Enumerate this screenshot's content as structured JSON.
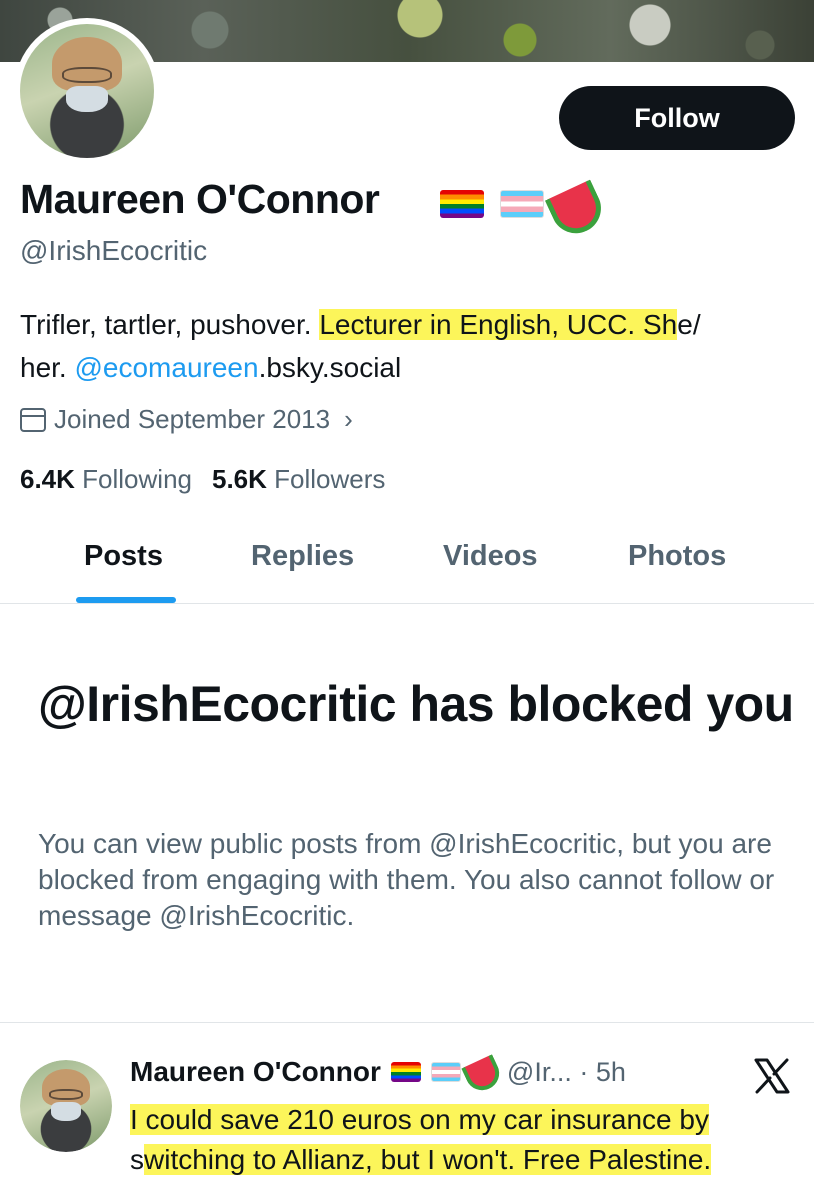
{
  "profile": {
    "name": "Maureen O'Connor",
    "handle": "@IrishEcocritic",
    "bio_prefix": "Trifler, tartler, pushover. ",
    "bio_highlight_1": "Lecturer in English, UCC. Sh",
    "bio_mid": "e/ ",
    "bio_line2_prefix": "her. ",
    "bio_link": "@ecomaureen",
    "bio_suffix": ".bsky.social",
    "joined": "Joined September 2013",
    "following_count": "6.4K",
    "following_label": "Following",
    "followers_count": "5.6K",
    "followers_label": "Followers",
    "icons": [
      "rainbow-flag-icon",
      "trans-flag-icon",
      "watermelon-icon",
      "calendar-icon",
      "chevron-right-icon"
    ]
  },
  "actions": {
    "follow_label": "Follow"
  },
  "tabs": [
    {
      "label": "Posts",
      "active": true
    },
    {
      "label": "Replies"
    },
    {
      "label": "Videos"
    },
    {
      "label": "Photos"
    }
  ],
  "blocked": {
    "title": "@IrishEcocritic has blocked you",
    "message": "You can view public posts from @IrishEcocritic, but you are blocked from engaging with them. You also cannot follow or message @IrishEcocritic."
  },
  "tweet": {
    "name": "Maureen O'Connor",
    "handle_time": "@Ir... · 5h",
    "text_line1": "I could save 210 euros on my car insurance by",
    "text_line2_a": "s",
    "text_line2_b": "witching to Allianz, but I won't. Free Palestine.",
    "icon": "x-logo-icon"
  },
  "colors": {
    "accent": "#1d9bf0",
    "highlight": "#fcf55a",
    "text": "#0f1419",
    "muted": "#536471"
  }
}
